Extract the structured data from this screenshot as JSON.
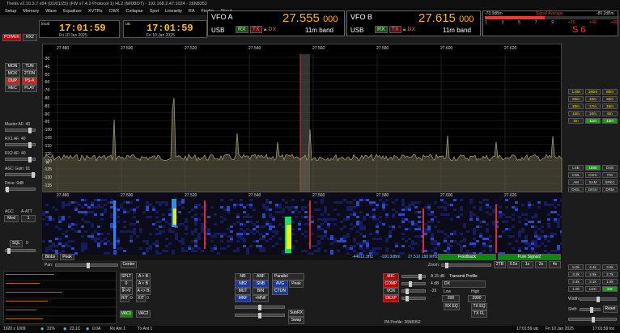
{
  "title_bar": "Thetis v2.10.3.7 x64 (01/01/25) (FW v7.4.2 Protocol 1) HL2 (MI0BOT) - 192.168.2.47:1024 - 26N8352",
  "menu": [
    "Setup",
    "Memory",
    "Wave",
    "Equalizer",
    "XVTRs",
    "CWX",
    "Collapse",
    "Spot",
    "Linearity",
    "RA",
    "Finder",
    "About"
  ],
  "clocks": {
    "local_label": "local",
    "local_time": "17:01:59",
    "local_date": "Fri 10 Jan 2025",
    "utc_label": "utc",
    "utc_time": "17:01:59",
    "utc_date": "Fri 10 Jan 2025"
  },
  "power": {
    "power": "POWER",
    "riq": "RX2"
  },
  "vfo_a": {
    "title": "VFO A",
    "freq_main": "27.555",
    "freq_sub": "000",
    "mode": "USB",
    "rx": "RX",
    "tx": "TX",
    "dx": "DX",
    "band": "11m band"
  },
  "vfo_b": {
    "title": "VFO B",
    "freq_main": "27.615",
    "freq_sub": "000",
    "mode": "USB",
    "rx": "RX",
    "tx": "TX",
    "dx": "DX",
    "band": "11m band"
  },
  "meter": {
    "left": "-73.9dBm",
    "signal_avg": "Signal Average",
    "right": "-80.2dBm",
    "scale": [
      "1",
      "3",
      "5",
      "7",
      "9",
      "+20",
      "+40",
      "+60"
    ],
    "reading": "S 6"
  },
  "left_buttons": [
    "MON",
    "TUN",
    "MOX",
    "2TON",
    "DUP",
    "PS-A",
    "REC",
    "PLAY"
  ],
  "left_controls": {
    "master_af": "Master AF:",
    "master_af_val": "40",
    "rx1_af": "RX1 AF:",
    "rx1_af_val": "40",
    "rx2_af": "RX2 AF:",
    "rx2_af_val": "40",
    "agc_gain": "AGC Gain:",
    "agc_gain_val": "91",
    "drive": "Drive:",
    "drive_val": "0dB",
    "agc": "AGC",
    "aatt": "A-ATT",
    "agc_mode": "Med",
    "aatt_val": "1",
    "sql": "SQL",
    "sql_val": "0"
  },
  "spectrum": {
    "freq_ticks": [
      "27.480",
      "27.500",
      "27.520",
      "27.540",
      "27.560",
      "27.580",
      "27.600",
      "27.620"
    ],
    "db_ticks": [
      "-30",
      "-40",
      "-50",
      "-60",
      "-70",
      "-80",
      "-85",
      "-90",
      "-95",
      "-100",
      "-105",
      "-110",
      "-115",
      "-120",
      "-125",
      "-130",
      "-135"
    ],
    "label_a": "A"
  },
  "waterfall": {
    "freq_ticks": [
      "27.480",
      "27.500",
      "27.520",
      "27.540",
      "27.560",
      "27.580",
      "27.600",
      "27.620"
    ],
    "bottom": {
      "blobs": "Blobs",
      "peak": "Peak",
      "left_val": "-44612.3Hz",
      "mid_val": "-100.3dBm",
      "right_val": "27.510 188 MHz",
      "feedback": "Feedback",
      "pure": "Pure Signal2"
    }
  },
  "pan_zoom": {
    "pan": "Pan:",
    "center": "Center",
    "zoom": "Zoom:",
    "buttons": [
      "2TB",
      "0.5x",
      "1x",
      "2x",
      "4x"
    ]
  },
  "band_buttons": [
    [
      "1.8M",
      "160m",
      "80m"
    ],
    [
      "60m",
      "40m",
      "30m"
    ],
    [
      "20m",
      "17m",
      "15m"
    ],
    [
      "12m",
      "10m",
      "6m"
    ],
    [
      "2m",
      "11m",
      "13m"
    ]
  ],
  "mode_buttons": [
    [
      "LSB",
      "USB",
      "DSB"
    ],
    [
      "CWL",
      "CWU",
      "FM"
    ],
    [
      "AM",
      "SAM",
      "SPEC"
    ],
    [
      "DIGL",
      "DIGU",
      "DRM"
    ]
  ],
  "filter_buttons": [
    [
      "5.0k",
      "4.4k",
      "3.8k"
    ],
    [
      "3.3k",
      "2.9k",
      "2.7k"
    ],
    [
      "2.4k",
      "2.1k",
      "1.8k"
    ],
    [
      "1.0k",
      "LDC",
      "DX"
    ]
  ],
  "filter_labels": {
    "width": "Width:",
    "shift": "Shift:",
    "reset": "Reset"
  },
  "vac": {
    "split": "SPLT",
    "a_to_b": "A > B",
    "beat": "0 Beat",
    "a_lt_b": "A < B",
    "if_v": "IF>V",
    "a_swap_b": "A <> B",
    "rit": "RIT",
    "xit": "XIT",
    "rit_val": "0",
    "xit_val": "0",
    "vac1": "VAC1",
    "vac2": "VAC2"
  },
  "dsp": {
    "nr": "NR",
    "anf": "ANF",
    "nb2": "NB2",
    "snb": "SNB",
    "mut": "MUT",
    "bin": "BIN",
    "mnf": "MNF",
    "plus_mnf": "+MNF",
    "parallel": "Parallel",
    "avg": "AVG",
    "peak": "Peak",
    "ctun": "CTUN",
    "subrx": "SubRX",
    "swap": "Swap"
  },
  "transmit": {
    "mic": "MIC",
    "mic_val": "A 15 dB",
    "comp": "COMP",
    "comp_val": "4 dB",
    "vox": "VOX",
    "vox_val": "-35",
    "dexp": "DEXP",
    "profile_label": "Transmit Profile",
    "profile": "DX",
    "low": "Low",
    "high": "High",
    "low_val": "200",
    "high_val": "2900",
    "rx_eq": "RX EQ",
    "tx_eq": "TX EQ",
    "tx_fl": "TX FL",
    "pa_profile": "PA Profile: 26N8352"
  },
  "status": {
    "res": "1920 x 1009",
    "cpu": "31%",
    "temp": "23.1C",
    "volt": "0.0A",
    "rx_ant": "Rx Ant 1",
    "tx_ant": "Tx Ant 1",
    "local_time": "17:01:59 utc",
    "date": "Fri 10 Jan 2025",
    "local_time2": "17:01:59 loc"
  }
}
